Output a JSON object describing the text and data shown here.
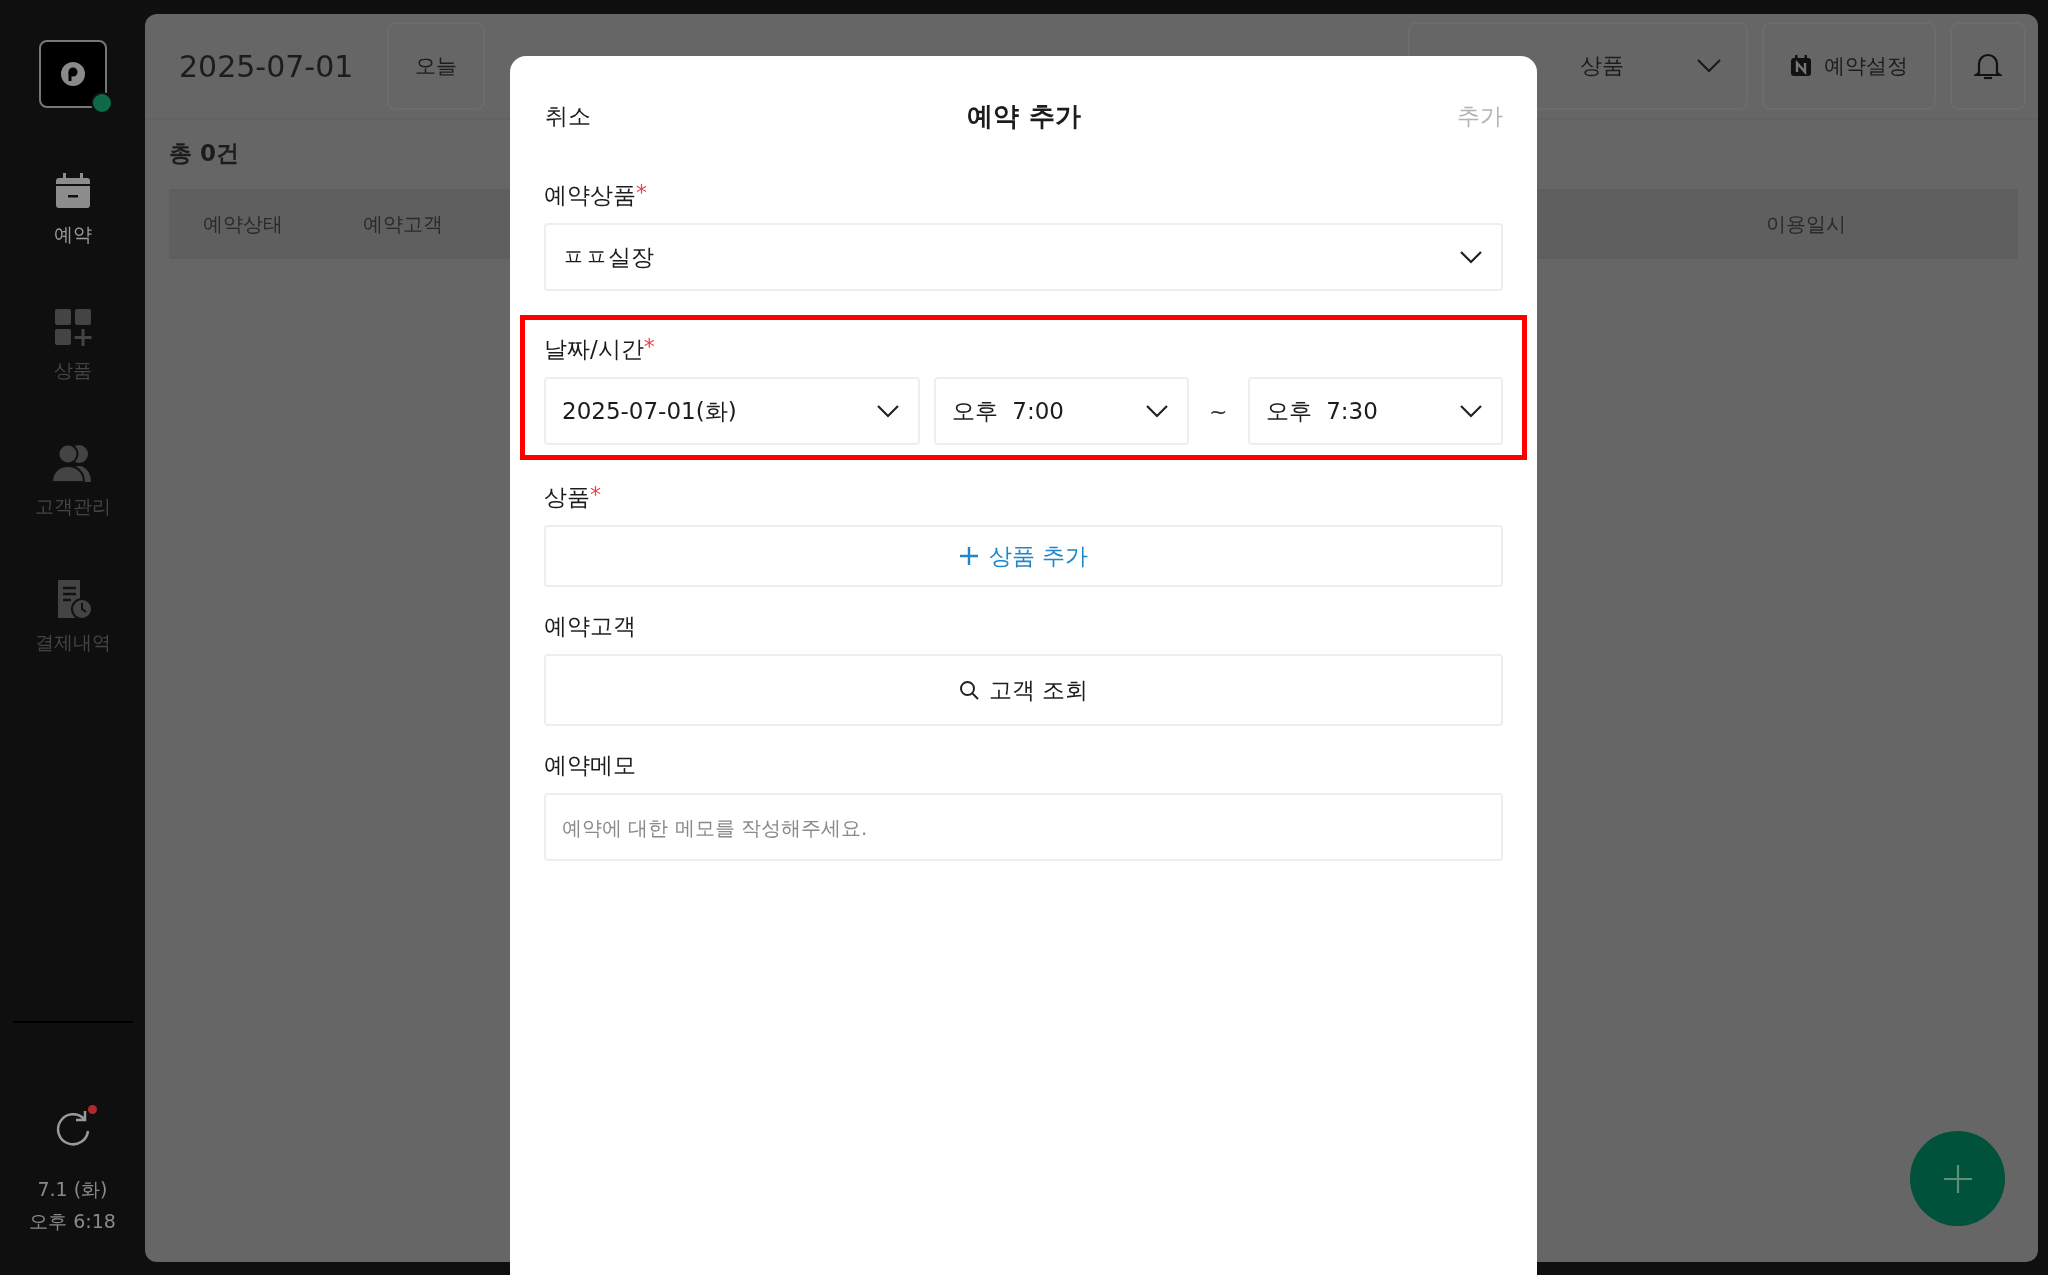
{
  "sidebar": {
    "items": [
      {
        "label": "예약",
        "kind": "calendar",
        "selected": true
      },
      {
        "label": "상품",
        "kind": "grid",
        "selected": false
      },
      {
        "label": "고객관리",
        "kind": "people",
        "selected": false
      },
      {
        "label": "결제내역",
        "kind": "receipt",
        "selected": false
      }
    ],
    "sync_pending": true,
    "date": "7.1 (화)",
    "time": "오후 6:18"
  },
  "toolbar": {
    "date": "2025-07-01",
    "today_button": "오늘",
    "product_filter": "상품",
    "settings_button": "예약설정"
  },
  "list": {
    "total": "총 0건",
    "columns": [
      "예약상태",
      "예약고객",
      "이용일시"
    ]
  },
  "modal": {
    "cancel": "취소",
    "title": "예약 추가",
    "confirm": "추가",
    "confirm_disabled": true,
    "sections": [
      {
        "kind": "select",
        "label": "예약상품",
        "required_mark": "*",
        "value": "ㅍㅍ실장"
      },
      {
        "kind": "datetime",
        "label": "날짜/시간",
        "required_mark": "*",
        "date": "2025-07-01(화)",
        "start": "오후  7:00",
        "separator": "~",
        "end": "오후  7:30",
        "highlighted": true
      },
      {
        "kind": "add",
        "label": "상품",
        "required_mark": "*",
        "button": "상품 추가"
      },
      {
        "kind": "search",
        "label": "예약고객",
        "button": "고객 조회"
      },
      {
        "kind": "memo",
        "label": "예약메모",
        "placeholder": "예약에 대한 메모를 작성해주세요."
      }
    ]
  }
}
